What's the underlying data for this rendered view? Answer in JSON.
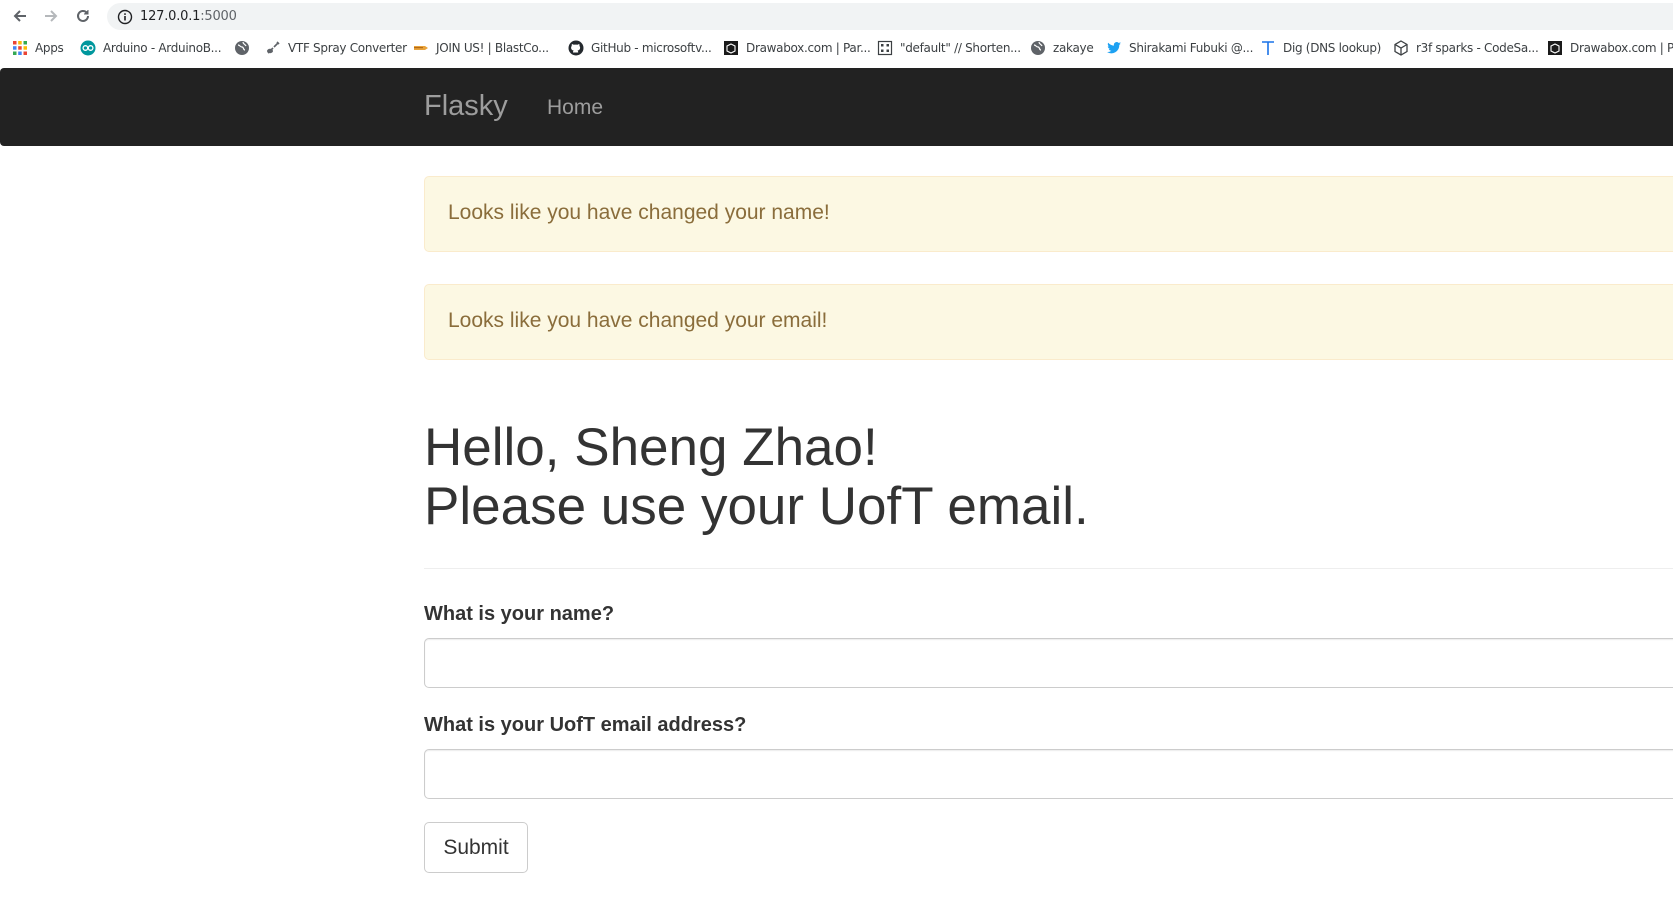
{
  "browser": {
    "url_host": "127.0.0.1",
    "url_port": ":5000",
    "bookmarks": [
      {
        "label": "Apps",
        "icon": "apps-grid-icon"
      },
      {
        "label": "Arduino - ArduinoB...",
        "icon": "arduino-icon"
      },
      {
        "label": "",
        "icon": "globe-icon"
      },
      {
        "label": "VTF Spray Converter",
        "icon": "guitar-icon"
      },
      {
        "label": "JOIN US! | BlastCo...",
        "icon": "blastco-icon"
      },
      {
        "label": "GitHub - microsoftv...",
        "icon": "github-icon"
      },
      {
        "label": "Drawabox.com | Par...",
        "icon": "drawabox-icon"
      },
      {
        "label": "\"default\" // Shorten...",
        "icon": "shorten-icon"
      },
      {
        "label": "zakaye",
        "icon": "globe-icon"
      },
      {
        "label": "Shirakami Fubuki @...",
        "icon": "twitter-icon"
      },
      {
        "label": "Dig (DNS lookup)",
        "icon": "t-letter-icon"
      },
      {
        "label": "r3f sparks - CodeSa...",
        "icon": "codesandbox-icon"
      },
      {
        "label": "Drawabox.com | Par",
        "icon": "drawabox-icon"
      }
    ]
  },
  "navbar": {
    "brand": "Flasky",
    "links": [
      "Home"
    ]
  },
  "alerts": [
    "Looks like you have changed your name!",
    "Looks like you have changed your email!"
  ],
  "header": {
    "line1": "Hello, Sheng Zhao!",
    "line2": "Please use your UofT email."
  },
  "form": {
    "name_label": "What is your name?",
    "name_value": "",
    "email_label": "What is your UofT email address?",
    "email_value": "",
    "submit_label": "Submit"
  },
  "colors": {
    "navbar_bg": "#222222",
    "navbar_text": "#9d9d9d",
    "alert_bg": "#fcf8e3",
    "alert_border": "#faebcc",
    "alert_text": "#8a6d3b"
  }
}
